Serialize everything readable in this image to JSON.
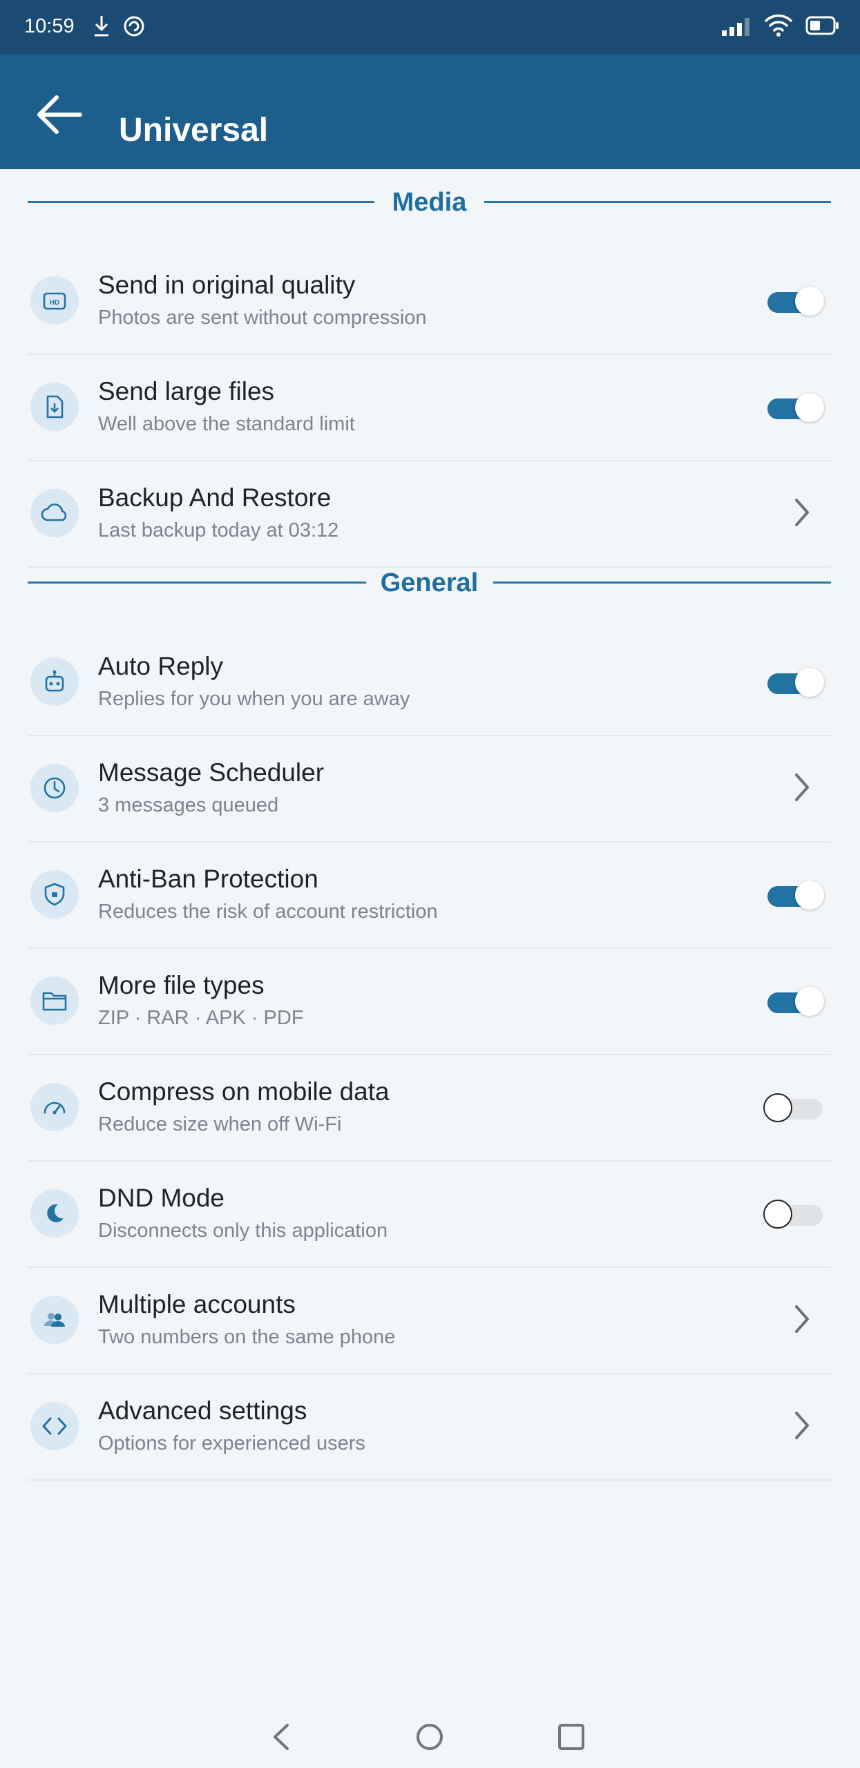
{
  "status_bar": {
    "time": "10:59"
  },
  "header": {
    "title": "Universal"
  },
  "sections": [
    {
      "title": "Media"
    },
    {
      "title": "General"
    }
  ],
  "rows": [
    {
      "title": "Send in original quality",
      "subtitle": "Photos are sent without compression",
      "icon": "hd-icon",
      "control": "toggle",
      "on": true
    },
    {
      "title": "Send large files",
      "subtitle": "Well above the standard limit",
      "icon": "file-download-icon",
      "control": "toggle",
      "on": true
    },
    {
      "title": "Backup And Restore",
      "subtitle": "Last backup today at 03:12",
      "icon": "cloud-icon",
      "control": "chevron"
    },
    {
      "title": "Auto Reply",
      "subtitle": "Replies for you when you are away",
      "icon": "robot-icon",
      "control": "toggle",
      "on": true
    },
    {
      "title": "Message Scheduler",
      "subtitle": "3 messages queued",
      "icon": "clock-icon",
      "control": "chevron"
    },
    {
      "title": "Anti-Ban Protection",
      "subtitle": "Reduces the risk of account restriction",
      "icon": "shield-icon",
      "control": "toggle",
      "on": true
    },
    {
      "title": "More file types",
      "subtitle": "ZIP · RAR · APK · PDF",
      "icon": "folder-icon",
      "control": "toggle",
      "on": true
    },
    {
      "title": "Compress on mobile data",
      "subtitle": "Reduce size when off Wi-Fi",
      "icon": "speedometer-icon",
      "control": "toggle",
      "on": false
    },
    {
      "title": "DND Mode",
      "subtitle": "Disconnects only this application",
      "icon": "moon-icon",
      "control": "toggle",
      "on": false
    },
    {
      "title": "Multiple accounts",
      "subtitle": "Two numbers on the same phone",
      "icon": "people-icon",
      "control": "chevron"
    },
    {
      "title": "Advanced settings",
      "subtitle": "Options for experienced users",
      "icon": "code-icon",
      "control": "chevron"
    }
  ],
  "colors": {
    "accent": "#2272a3",
    "status_bar": "#1b4a72",
    "app_bar": "#1e5e8c",
    "background": "#f2f6f9"
  }
}
